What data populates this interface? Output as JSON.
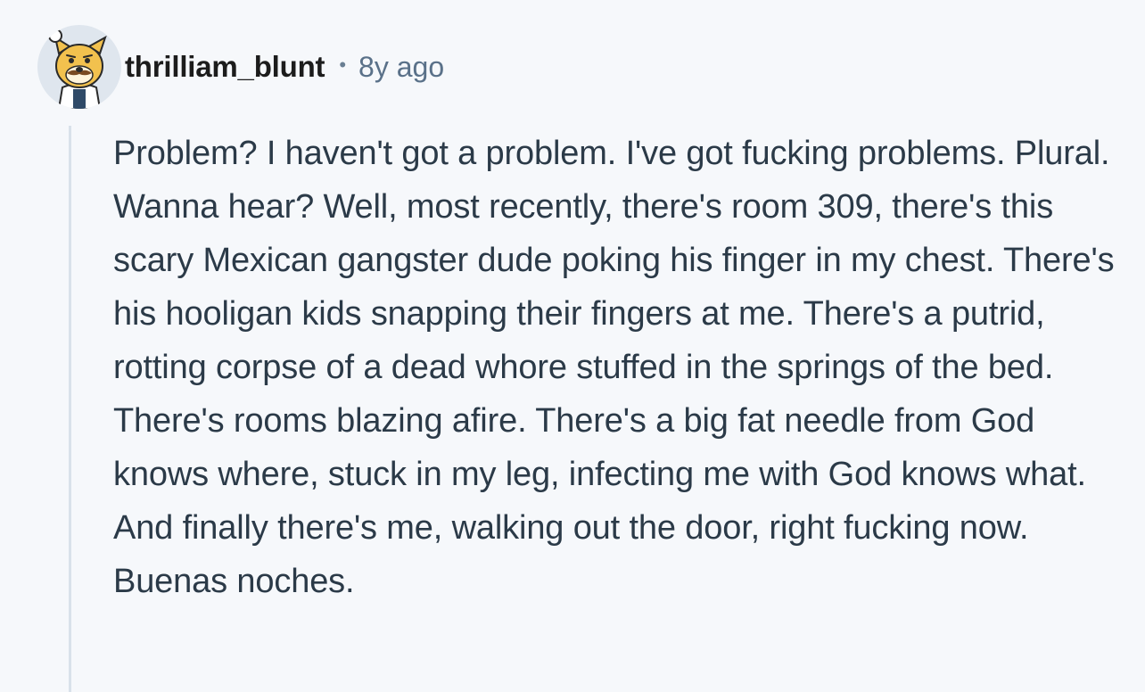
{
  "comment": {
    "username": "thrilliam_blunt",
    "separator": "•",
    "timestamp": "8y ago",
    "avatar_icon": "doge-chef-avatar-icon",
    "body": "Problem? I haven't got a problem. I've got fucking problems. Plural. Wanna hear? Well, most recently, there's room 309, there's this scary Mexican gangster dude poking his finger in my chest. There's his hooligan kids snapping their fingers at me. There's a putrid, rotting corpse of a dead whore stuffed in the springs of the bed. There's rooms blazing afire. There's a big fat needle from God knows where, stuck in my leg, infecting me with God knows what. And finally there's me, walking out the door, right fucking now. Buenas noches."
  },
  "colors": {
    "background": "#f6f8fb",
    "username": "#1c1c1c",
    "timestamp": "#5a7189",
    "body_text": "#2b3a48",
    "thread_line": "#d9e1ea"
  }
}
